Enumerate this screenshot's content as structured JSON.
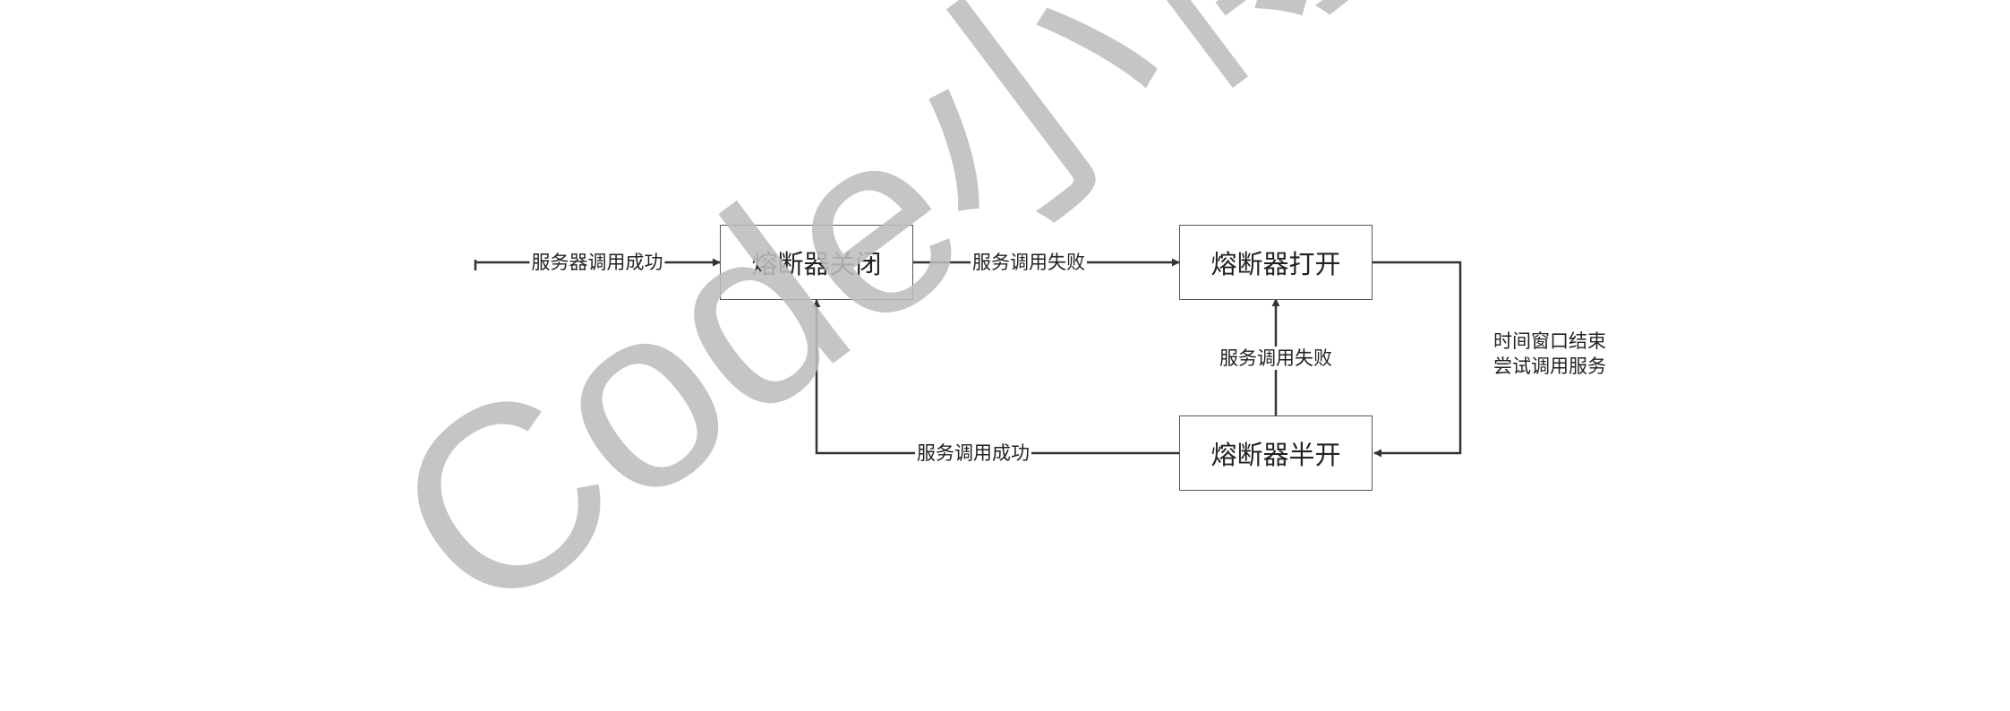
{
  "diagram": {
    "nodes": {
      "closed": "熔断器关闭",
      "open": "熔断器打开",
      "half_open": "熔断器半开"
    },
    "edges": {
      "start_to_closed": "服务器调用成功",
      "closed_to_open": "服务调用失败",
      "half_open_to_open": "服务调用失败",
      "half_open_to_closed": "服务调用成功",
      "open_to_half_open_line1": "时间窗口结束",
      "open_to_half_open_line2": "尝试调用服务"
    }
  },
  "watermark": {
    "text": "Code小博·",
    "color": "#bdbdbd"
  },
  "colors": {
    "line": "#333333",
    "box_border": "#555555"
  }
}
